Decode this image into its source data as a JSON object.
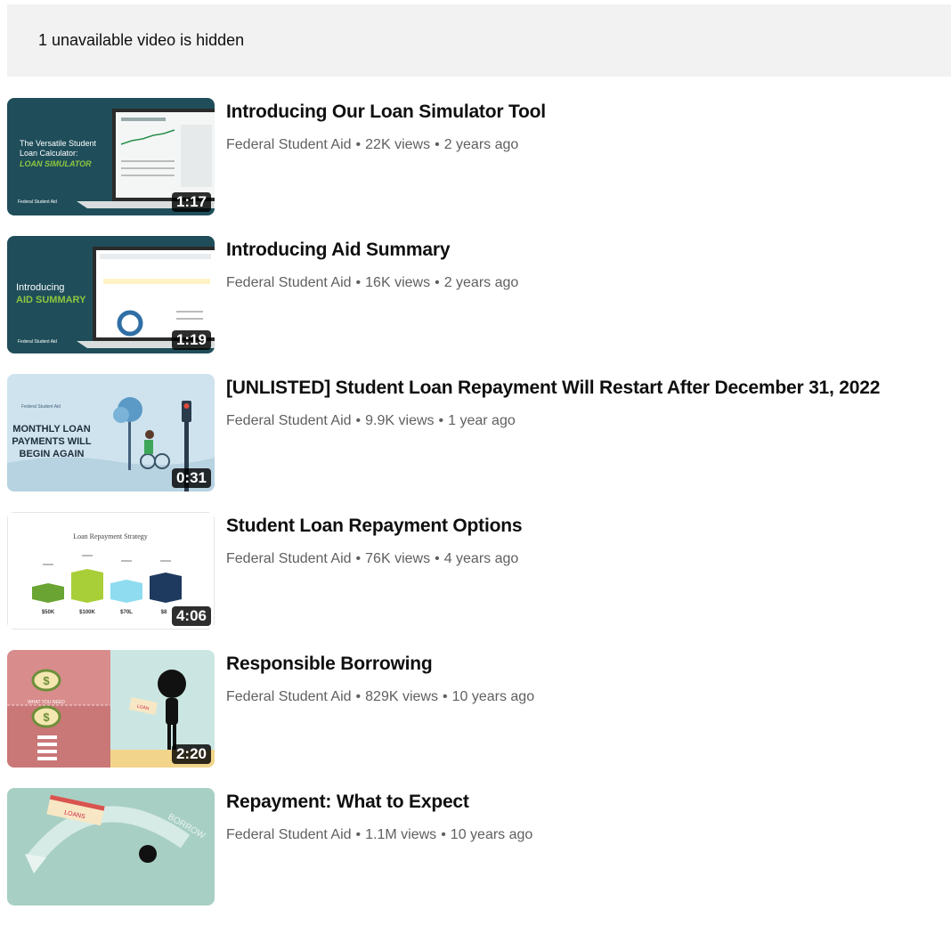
{
  "banner": {
    "text": "1 unavailable video is hidden"
  },
  "separator": "•",
  "videos": [
    {
      "title": "Introducing Our Loan Simulator Tool",
      "channel": "Federal Student Aid",
      "views": "22K views",
      "age": "2 years ago",
      "duration": "1:17",
      "thumb_lines": [
        "The Versatile Student",
        "Loan Calculator:",
        "LOAN SIMULATOR"
      ],
      "thumb_brand": "Federal Student Aid"
    },
    {
      "title": "Introducing Aid Summary",
      "channel": "Federal Student Aid",
      "views": "16K views",
      "age": "2 years ago",
      "duration": "1:19",
      "thumb_lines": [
        "Introducing",
        "AID SUMMARY"
      ],
      "thumb_brand": "Federal Student Aid"
    },
    {
      "title": "[UNLISTED] Student Loan Repayment Will Restart After December 31, 2022",
      "channel": "Federal Student Aid",
      "views": "9.9K views",
      "age": "1 year ago",
      "duration": "0:31",
      "thumb_lines": [
        "MONTHLY LOAN",
        "PAYMENTS WILL",
        "BEGIN AGAIN"
      ],
      "thumb_brand": "Federal Student Aid"
    },
    {
      "title": "Student Loan Repayment Options",
      "channel": "Federal Student Aid",
      "views": "76K views",
      "age": "4 years ago",
      "duration": "4:06",
      "thumb_heading": "Loan Repayment Strategy",
      "thumb_labels": [
        "$50K",
        "$100K",
        "$70L",
        "$8"
      ]
    },
    {
      "title": "Responsible Borrowing",
      "channel": "Federal Student Aid",
      "views": "829K views",
      "age": "10 years ago",
      "duration": "2:20",
      "thumb_lines": [
        "WHAT YOU NEED"
      ],
      "thumb_sign": "LOAN"
    },
    {
      "title": "Repayment: What to Expect",
      "channel": "Federal Student Aid",
      "views": "1.1M views",
      "age": "10 years ago",
      "duration": "",
      "thumb_sign": "LOANS",
      "thumb_arc": "BORROW"
    }
  ],
  "colors": {
    "banner_bg": "#f2f2f2",
    "meta_text": "#606060",
    "title_text": "#0f0f0f",
    "teal_dark": "#1f4e5a",
    "accent_green": "#8dc63f"
  }
}
